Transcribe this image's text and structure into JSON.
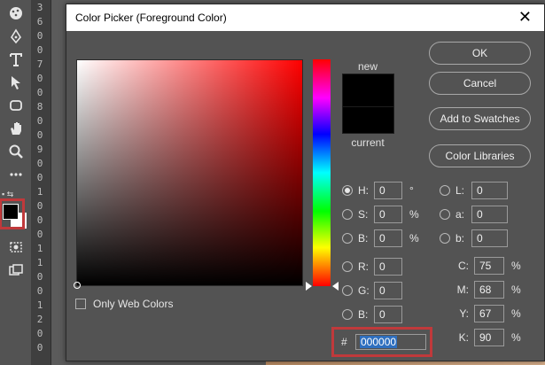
{
  "dialog": {
    "title": "Color Picker (Foreground Color)",
    "close_glyph": "✕"
  },
  "preview": {
    "new_label": "new",
    "current_label": "current",
    "new_color": "#000000",
    "current_color": "#000000"
  },
  "buttons": {
    "ok": "OK",
    "cancel": "Cancel",
    "add_to_swatches": "Add to Swatches",
    "color_libraries": "Color Libraries"
  },
  "only_web_colors_label": "Only Web Colors",
  "hsb": {
    "h": {
      "label": "H:",
      "value": "0",
      "unit": "°",
      "selected": true
    },
    "s": {
      "label": "S:",
      "value": "0",
      "unit": "%"
    },
    "b": {
      "label": "B:",
      "value": "0",
      "unit": "%"
    }
  },
  "lab": {
    "l": {
      "label": "L:",
      "value": "0"
    },
    "a": {
      "label": "a:",
      "value": "0"
    },
    "b": {
      "label": "b:",
      "value": "0"
    }
  },
  "rgb": {
    "r": {
      "label": "R:",
      "value": "0"
    },
    "g": {
      "label": "G:",
      "value": "0"
    },
    "b": {
      "label": "B:",
      "value": "0"
    }
  },
  "cmyk": {
    "c": {
      "label": "C:",
      "value": "75",
      "unit": "%"
    },
    "m": {
      "label": "M:",
      "value": "68",
      "unit": "%"
    },
    "y": {
      "label": "Y:",
      "value": "67",
      "unit": "%"
    },
    "k": {
      "label": "K:",
      "value": "90",
      "unit": "%"
    }
  },
  "hex": {
    "label": "#",
    "value": "000000"
  },
  "ruler_numbers": [
    "3",
    "6",
    "0",
    "0",
    "7",
    "0",
    "0",
    "8",
    "0",
    "0",
    "9",
    "0",
    "0",
    "1",
    "0",
    "0",
    "0",
    "1",
    "1",
    "0",
    "0",
    "1",
    "2",
    "0",
    "0"
  ],
  "colors": {
    "highlight": "#c0393b",
    "selection": "#2e6fbf"
  }
}
